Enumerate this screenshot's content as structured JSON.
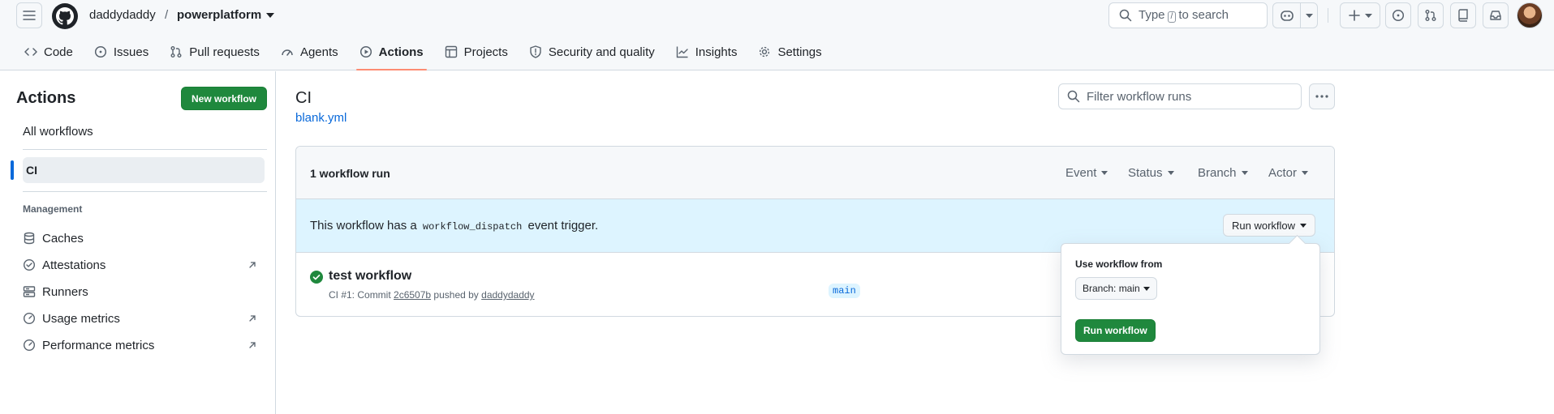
{
  "header": {
    "owner": "daddydaddy",
    "separator": "/",
    "repo": "powerplatform",
    "search_prefix": "Type",
    "search_key": "/",
    "search_suffix": "to search"
  },
  "tabs": [
    {
      "label": "Code",
      "icon": "code-icon"
    },
    {
      "label": "Issues",
      "icon": "issue-icon"
    },
    {
      "label": "Pull requests",
      "icon": "pull-request-icon"
    },
    {
      "label": "Agents",
      "icon": "agents-icon"
    },
    {
      "label": "Actions",
      "icon": "play-icon",
      "active": true
    },
    {
      "label": "Projects",
      "icon": "table-icon"
    },
    {
      "label": "Security and quality",
      "icon": "shield-icon"
    },
    {
      "label": "Insights",
      "icon": "graph-icon"
    },
    {
      "label": "Settings",
      "icon": "gear-icon"
    }
  ],
  "sidebar": {
    "title": "Actions",
    "new_workflow": "New workflow",
    "all_workflows": "All workflows",
    "selected_workflow": "CI",
    "management_heading": "Management",
    "links": [
      {
        "label": "Caches",
        "icon": "database-icon",
        "external": false
      },
      {
        "label": "Attestations",
        "icon": "verified-icon",
        "external": true
      },
      {
        "label": "Runners",
        "icon": "server-icon",
        "external": false
      },
      {
        "label": "Usage metrics",
        "icon": "metrics-icon",
        "external": true
      },
      {
        "label": "Performance metrics",
        "icon": "metrics-icon",
        "external": true
      }
    ]
  },
  "main": {
    "title": "CI",
    "file": "blank.yml",
    "filter_placeholder": "Filter workflow runs",
    "runs_count": "1 workflow run",
    "filters": [
      "Event",
      "Status",
      "Branch",
      "Actor"
    ],
    "dispatch": {
      "prefix": "This workflow has a",
      "code": "workflow_dispatch",
      "suffix": "event trigger.",
      "button": "Run workflow"
    },
    "run": {
      "title": "test workflow",
      "prefix": "CI #1: Commit",
      "commit": "2c6507b",
      "pushed_by": "pushed by",
      "user": "daddydaddy",
      "branch": "main"
    }
  },
  "popover": {
    "label": "Use workflow from",
    "branch_button": "Branch: main",
    "run_button": "Run workflow"
  },
  "colors": {
    "primary_green": "#1f883d",
    "link_blue": "#0969da",
    "active_tab_underline": "#fd8c73",
    "dispatch_bg": "#ddf4ff"
  }
}
